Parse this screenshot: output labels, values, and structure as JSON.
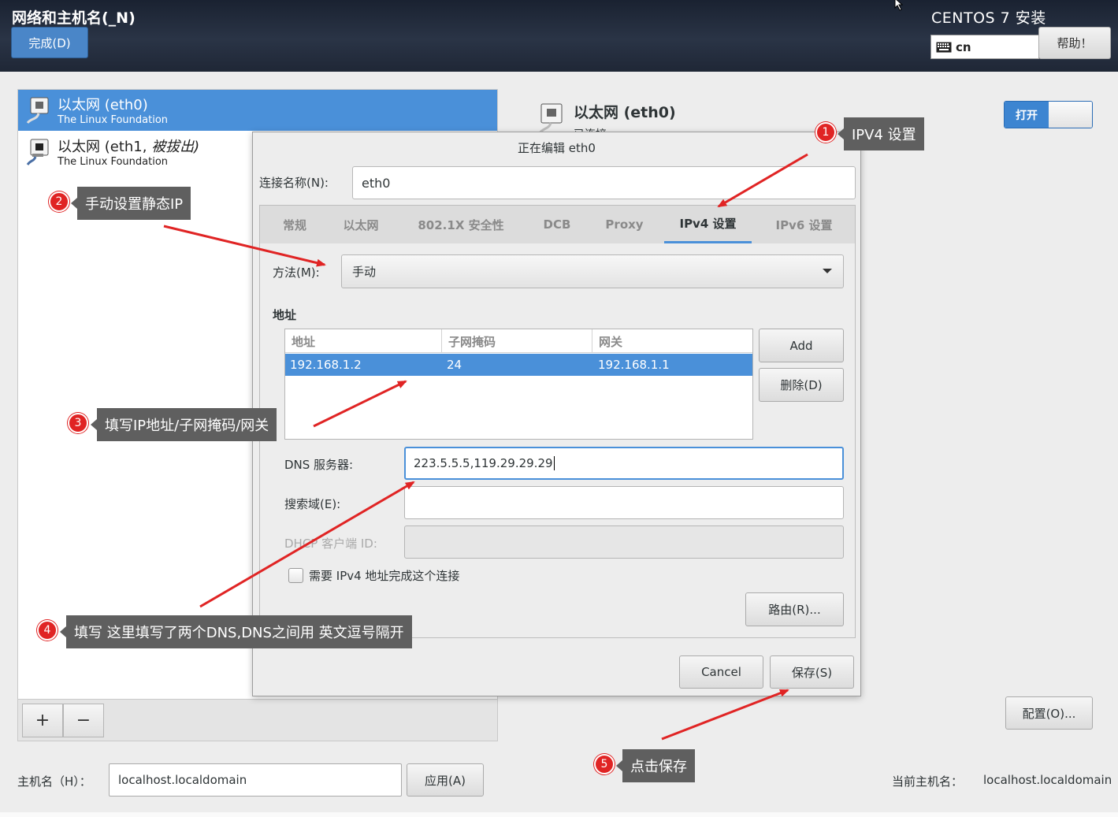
{
  "header": {
    "screen_title": "网络和主机名(_N)",
    "done_label": "完成(D)",
    "install_title": "CENTOS 7 安装",
    "keyboard_layout": "cn",
    "help_label": "帮助！"
  },
  "connections": [
    {
      "name": "以太网 (eth0)",
      "vendor": "The Linux Foundation",
      "selected": true
    },
    {
      "name": "以太网 (eth1, ",
      "name_italic": "被拔出)",
      "vendor": "The Linux Foundation",
      "selected": false
    }
  ],
  "list_toolbar": {
    "add_label": "+",
    "remove_label": "−"
  },
  "device": {
    "title": "以太网 (eth0)",
    "status": "已连接",
    "switch_label": "打开",
    "config_label": "配置(O)..."
  },
  "hostname": {
    "label": "主机名（H）：",
    "value": "localhost.localdomain",
    "apply_label": "应用(A)",
    "current_label": "当前主机名：",
    "current_value": "localhost.localdomain"
  },
  "dialog": {
    "title": "正在编辑 eth0",
    "conn_name_label": "连接名称(N):",
    "conn_name_value": "eth0",
    "tabs": [
      "常规",
      "以太网",
      "802.1X 安全性",
      "DCB",
      "Proxy",
      "IPv4 设置",
      "IPv6 设置"
    ],
    "active_tab": "IPv4 设置",
    "method_label": "方法(M):",
    "method_value": "手动",
    "addresses_heading": "地址",
    "address_columns": [
      "地址",
      "子网掩码",
      "网关"
    ],
    "address_rows": [
      [
        "192.168.1.2",
        "24",
        "192.168.1.1"
      ]
    ],
    "add_label": "Add",
    "delete_label": "删除(D)",
    "dns_label": "DNS 服务器:",
    "dns_value": "223.5.5.5,119.29.29.29",
    "search_label": "搜索域(E):",
    "search_value": "",
    "dhcp_label": "DHCP 客户端 ID:",
    "dhcp_value": "",
    "require_ipv4_label": "需要 IPv4 地址完成这个连接",
    "require_ipv4_checked": false,
    "routes_label": "路由(R)...",
    "cancel_label": "Cancel",
    "save_label": "保存(S)"
  },
  "annotations": [
    {
      "num": "1",
      "text": "IPV4 设置"
    },
    {
      "num": "2",
      "text": "手动设置静态IP"
    },
    {
      "num": "3",
      "text": "填写IP地址/子网掩码/网关"
    },
    {
      "num": "4",
      "text": "填写 这里填写了两个DNS,DNS之间用 英文逗号隔开"
    },
    {
      "num": "5",
      "text": "点击保存"
    }
  ],
  "colors": {
    "accent": "#4a90d9",
    "annotation_red": "#e02424",
    "tooltip_bg": "#5f5f5f"
  }
}
